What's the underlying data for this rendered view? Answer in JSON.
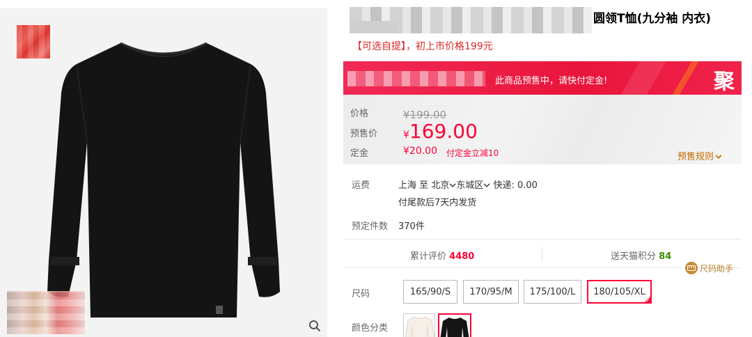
{
  "product": {
    "title_suffix": "圆领T恤(九分袖 内衣)",
    "subtitle": "【可选自提】，初上市价格199元"
  },
  "banner": {
    "text": "此商品预售中，请快付定金!",
    "badge": "聚"
  },
  "price": {
    "label_price": "价格",
    "original": "¥199.00",
    "label_presale": "预售价",
    "currency": "¥",
    "presale": "169.00",
    "label_deposit": "定金",
    "deposit": "¥20.00",
    "deposit_note": "付定金立减10",
    "rules": "预售规则"
  },
  "shipping": {
    "label": "运费",
    "from": "上海",
    "to_word": "至",
    "city": "北京",
    "district": "东城区",
    "express": "快递: 0.00",
    "delivery": "付尾款后7天内发货"
  },
  "reservations": {
    "label": "预定件数",
    "count": "370件"
  },
  "stats": {
    "reviews_label": "累计评价",
    "reviews_count": "4480",
    "points_label": "送天猫积分",
    "points_count": "84"
  },
  "size_helper": {
    "label": "尺码助手",
    "icon": "ruler-icon"
  },
  "size": {
    "label": "尺码",
    "options": [
      "165/90/S",
      "170/95/M",
      "175/100/L",
      "180/105/XL"
    ],
    "selected": "180/105/XL"
  },
  "color": {
    "label": "颜色分类",
    "options": [
      "white",
      "black"
    ],
    "selected": "black"
  },
  "colors": {
    "accent": "#ff0036",
    "banner": "#ef1a47",
    "green": "#3c8d00",
    "rules": "#c36b00"
  }
}
